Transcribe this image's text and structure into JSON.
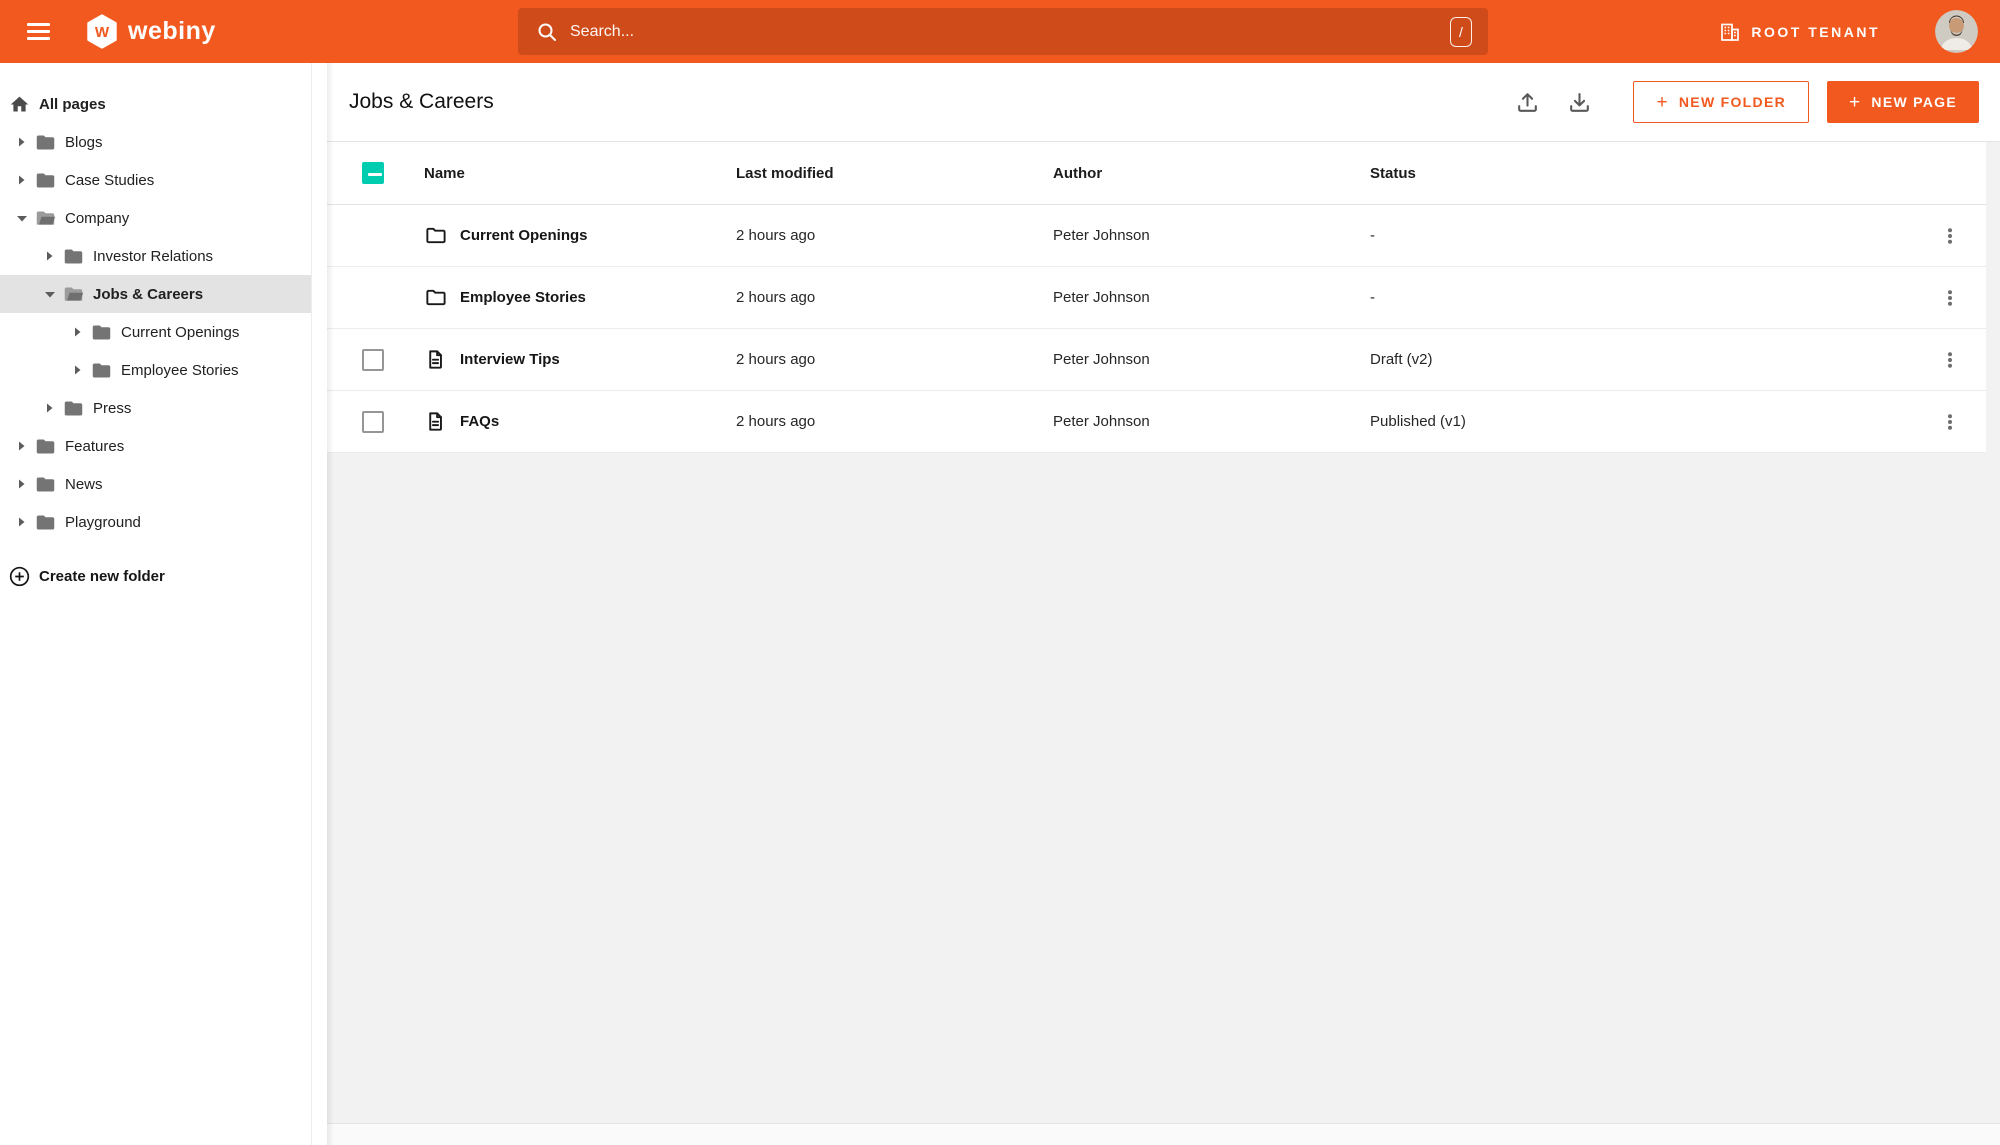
{
  "colors": {
    "primary_orange": "#f2591f",
    "checkbox_teal": "#00ccb0",
    "sidebar_selected_bg": "#e3e3e3"
  },
  "topbar": {
    "brand": "webiny",
    "search": {
      "placeholder": "Search...",
      "shortcut": "/"
    },
    "tenant_label": "ROOT TENANT"
  },
  "sidebar": {
    "items": [
      {
        "label": "All pages",
        "level": 0,
        "icon": "home",
        "bold": true
      },
      {
        "label": "Blogs",
        "level": 0,
        "icon": "folder",
        "expanded": false
      },
      {
        "label": "Case Studies",
        "level": 0,
        "icon": "folder",
        "expanded": false
      },
      {
        "label": "Company",
        "level": 0,
        "icon": "folder-open",
        "expanded": true
      },
      {
        "label": "Investor Relations",
        "level": 1,
        "icon": "folder",
        "expanded": false
      },
      {
        "label": "Jobs & Careers",
        "level": 1,
        "icon": "folder-open",
        "expanded": true,
        "selected": true,
        "bold": true
      },
      {
        "label": "Current Openings",
        "level": 2,
        "icon": "folder",
        "expanded": false
      },
      {
        "label": "Employee Stories",
        "level": 2,
        "icon": "folder",
        "expanded": false
      },
      {
        "label": "Press",
        "level": 1,
        "icon": "folder",
        "expanded": false
      },
      {
        "label": "Features",
        "level": 0,
        "icon": "folder",
        "expanded": false
      },
      {
        "label": "News",
        "level": 0,
        "icon": "folder",
        "expanded": false
      },
      {
        "label": "Playground",
        "level": 0,
        "icon": "folder",
        "expanded": false
      }
    ],
    "create_folder_label": "Create new folder"
  },
  "main": {
    "title": "Jobs & Careers",
    "buttons": {
      "new_folder": "NEW FOLDER",
      "new_page": "NEW PAGE",
      "plus": "+"
    },
    "table": {
      "columns": {
        "name": "Name",
        "modified": "Last modified",
        "author": "Author",
        "status": "Status"
      },
      "rows": [
        {
          "name": "Current Openings",
          "type": "folder",
          "modified": "2 hours ago",
          "author": "Peter Johnson",
          "status": "-"
        },
        {
          "name": "Employee Stories",
          "type": "folder",
          "modified": "2 hours ago",
          "author": "Peter Johnson",
          "status": "-"
        },
        {
          "name": "Interview Tips",
          "type": "page",
          "modified": "2 hours ago",
          "author": "Peter Johnson",
          "status": "Draft (v2)"
        },
        {
          "name": "FAQs",
          "type": "page",
          "modified": "2 hours ago",
          "author": "Peter Johnson",
          "status": "Published (v1)"
        }
      ]
    }
  }
}
